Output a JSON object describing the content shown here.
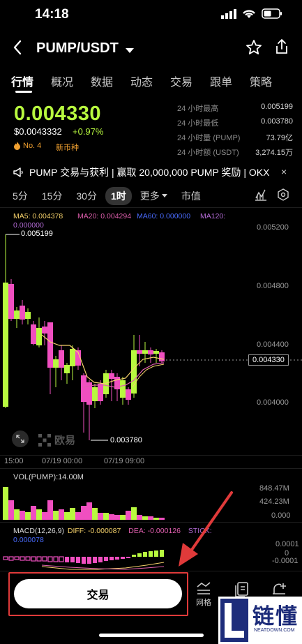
{
  "status": {
    "time": "14:18"
  },
  "header": {
    "title": "PUMP/USDT"
  },
  "tabs": [
    "行情",
    "概况",
    "数据",
    "动态",
    "交易",
    "跟单",
    "策略"
  ],
  "ticker": {
    "price": "0.004330",
    "usd_price": "$0.0043332",
    "change": "+0.97%",
    "rank": "No. 4",
    "tag": "新币种",
    "stats": [
      {
        "label": "24 小时最高",
        "value": "0.005199"
      },
      {
        "label": "24 小时最低",
        "value": "0.003780"
      },
      {
        "label": "24 小时量 (PUMP)",
        "value": "73.79亿"
      },
      {
        "label": "24 小时额 (USDT)",
        "value": "3,274.15万"
      }
    ]
  },
  "promo": {
    "text": "PUMP 交易与获利 | 赢取 20,000,000 PUMP 奖励 | OKX",
    "close": "×"
  },
  "intervals": {
    "items": [
      "5分",
      "15分",
      "30分",
      "1时"
    ],
    "more": "更多",
    "market_value": "市值",
    "active": "1时"
  },
  "chart": {
    "ma5": "MA5: 0.004378",
    "ma20": "MA20: 0.004294",
    "ma60": "MA60: 0.000000",
    "ma120a": "MA120:",
    "ma120b": "0.000000",
    "y_ticks": [
      "0.005200",
      "0.004800",
      "0.004400",
      "0.004000"
    ],
    "high_label": "0.005199",
    "low_label": "0.003780",
    "last_label": "0.004330",
    "watermark": "欧易",
    "x_ticks": [
      "15:00",
      "07/19 00:00",
      "07/19 09:00"
    ],
    "vol_label": "VOL(PUMP):14.00M",
    "vol_ticks": [
      "848.47M",
      "424.23M",
      "0.000"
    ],
    "macd_label": "MACD(12,26,9)",
    "diff_label": "DIFF: -0.000087",
    "dea_label": "DEA: -0.000126",
    "stick_label": "STICK:",
    "stick_val": "0.000078",
    "macd_ticks": [
      "0.0001",
      "0",
      "-0.0001"
    ],
    "colors": {
      "up": "#b8f93f",
      "down": "#f04fc0",
      "ma5": "#f5d16a",
      "ma20": "#e05fae",
      "ma60": "#4a6cff",
      "ma120": "#b36bd6"
    }
  },
  "bottom": {
    "trade": "交易",
    "grid": "网格"
  },
  "watermark_logo": {
    "text": "链懂",
    "sub": "NEATDOWN.COM"
  }
}
